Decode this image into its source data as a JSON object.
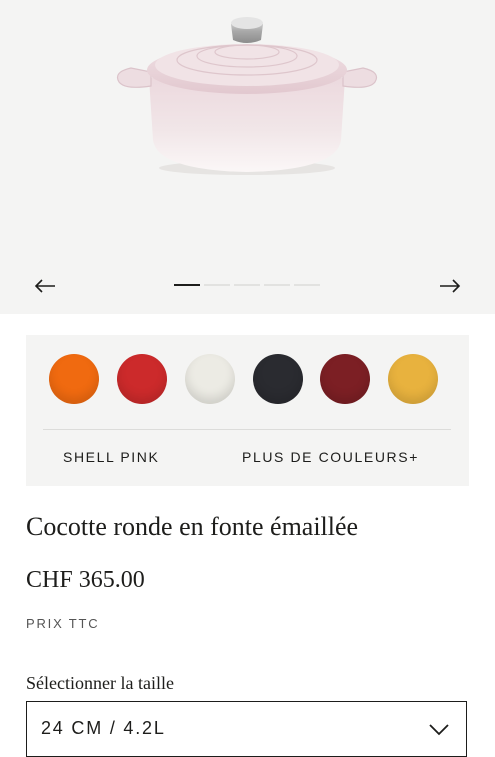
{
  "gallery": {
    "product_image": "shell-pink-round-cocotte",
    "prev_icon": "arrow-left-icon",
    "next_icon": "arrow-right-icon",
    "slide_count": 5,
    "active_slide": 1
  },
  "colors": {
    "swatches": [
      {
        "name": "orange",
        "hex": "#f06a10"
      },
      {
        "name": "red",
        "hex": "#cc2a2b"
      },
      {
        "name": "cream",
        "hex": "#ecebe4"
      },
      {
        "name": "black",
        "hex": "#2a2b30"
      },
      {
        "name": "burgundy",
        "hex": "#7c1f24"
      },
      {
        "name": "yellow",
        "hex": "#e8b23e"
      }
    ],
    "selected_label": "SHELL PINK",
    "more_label": "PLUS DE COULEURS+"
  },
  "product": {
    "title": "Cocotte ronde en fonte émaillée",
    "price": "CHF 365.00",
    "price_note": "PRIX TTC"
  },
  "size": {
    "label": "Sélectionner la taille",
    "value": "24 CM / 4.2L",
    "chevron_icon": "chevron-down-icon"
  }
}
